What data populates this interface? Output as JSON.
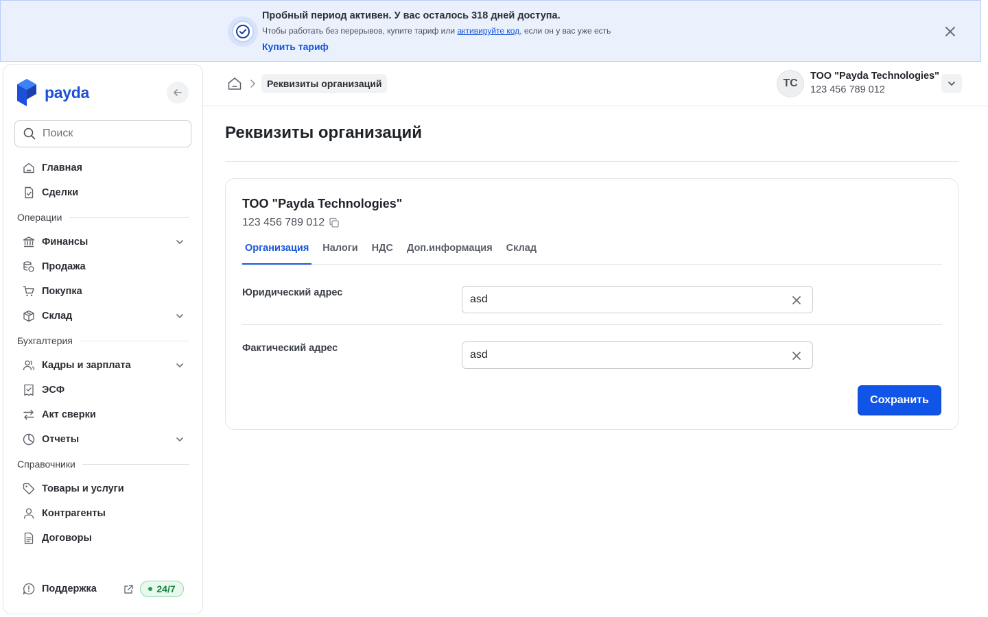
{
  "banner": {
    "title": "Пробный период активен. У вас осталось 318 дней доступа.",
    "text_before": "Чтобы работать без перерывов, купите тариф или ",
    "link": "активируйте код",
    "text_after": ", если он у вас уже есть",
    "buy": "Купить тариф",
    "icon": "check-circle-icon"
  },
  "sidebar": {
    "logo": "payda",
    "search_placeholder": "Поиск",
    "items": [
      {
        "label": "Главная",
        "icon": "home-icon"
      },
      {
        "label": "Сделки",
        "icon": "document-check-icon"
      }
    ],
    "section_operations": "Операции",
    "operations": [
      {
        "label": "Финансы",
        "icon": "bank-icon",
        "expandable": true
      },
      {
        "label": "Продажа",
        "icon": "coins-icon"
      },
      {
        "label": "Покупка",
        "icon": "cart-icon"
      },
      {
        "label": "Склад",
        "icon": "box-icon",
        "expandable": true
      }
    ],
    "section_accounting": "Бухгалтерия",
    "accounting": [
      {
        "label": "Кадры и зарплата",
        "icon": "users-icon",
        "expandable": true
      },
      {
        "label": "ЭСФ",
        "icon": "receipt-icon"
      },
      {
        "label": "Акт сверки",
        "icon": "arrows-exchange-icon"
      },
      {
        "label": "Отчеты",
        "icon": "pie-chart-icon",
        "expandable": true
      }
    ],
    "section_references": "Справочники",
    "references": [
      {
        "label": "Товары и услуги",
        "icon": "tag-icon"
      },
      {
        "label": "Контрагенты",
        "icon": "user-icon"
      },
      {
        "label": "Договоры",
        "icon": "file-text-icon"
      }
    ],
    "support": {
      "label": "Поддержка",
      "badge": "24/7"
    }
  },
  "header": {
    "breadcrumb_current": "Реквизиты организаций",
    "avatar_initials": "TC",
    "org_name": "ТОО \"Payda Technologies\"",
    "org_bin": "123 456 789 012"
  },
  "main": {
    "title": "Реквизиты организаций",
    "card": {
      "org_name": "ТОО \"Payda Technologies\"",
      "org_bin": "123 456 789 012",
      "tabs": [
        "Организация",
        "Налоги",
        "НДС",
        "Доп.информация",
        "Склад"
      ],
      "active_tab": "Организация",
      "fields": [
        {
          "label": "Юридический адрес",
          "value": "asd"
        },
        {
          "label": "Фактический адрес",
          "value": "asd"
        }
      ],
      "save": "Сохранить"
    }
  },
  "colors": {
    "accent": "#1655d9",
    "primary_button": "#1155e8",
    "banner_bg": "#eaf1fd",
    "success": "#15843e"
  }
}
